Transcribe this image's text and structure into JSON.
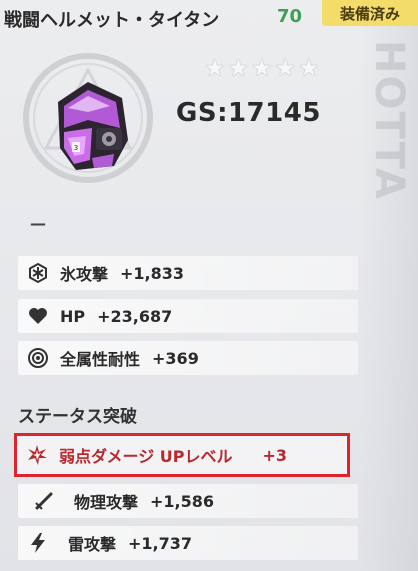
{
  "header": {
    "item_name": "戦闘ヘルメット・タイタン",
    "item_level": "70",
    "equipped_label": "装備済み"
  },
  "background": {
    "deco_text": "HOTTA"
  },
  "rating": {
    "stars_total": 5,
    "stars_filled": 0
  },
  "gear_score": "GS:17145",
  "stats": [
    {
      "icon": "snowflake-icon",
      "name": "氷攻撃",
      "value": "+1,833"
    },
    {
      "icon": "heart-icon",
      "name": "HP",
      "value": "+23,687"
    },
    {
      "icon": "resistance-ring-icon",
      "name": "全属性耐性",
      "value": "+369"
    }
  ],
  "breakthrough": {
    "title": "ステータス突破",
    "highlight": {
      "icon": "weakness-burst-icon",
      "name": "弱点ダメージ UPレベル",
      "value": "+3"
    },
    "items": [
      {
        "icon": "sword-icon",
        "name": "物理攻撃",
        "value": "+1,586"
      },
      {
        "icon": "lightning-icon",
        "name": "雷攻撃",
        "value": "+1,737"
      }
    ]
  },
  "colors": {
    "level": "#3fa055",
    "badge_bg": "#f3dc6a",
    "highlight_border": "#e0242e",
    "highlight_text": "#b8282c",
    "helmet_purple": "#b25ad6"
  }
}
